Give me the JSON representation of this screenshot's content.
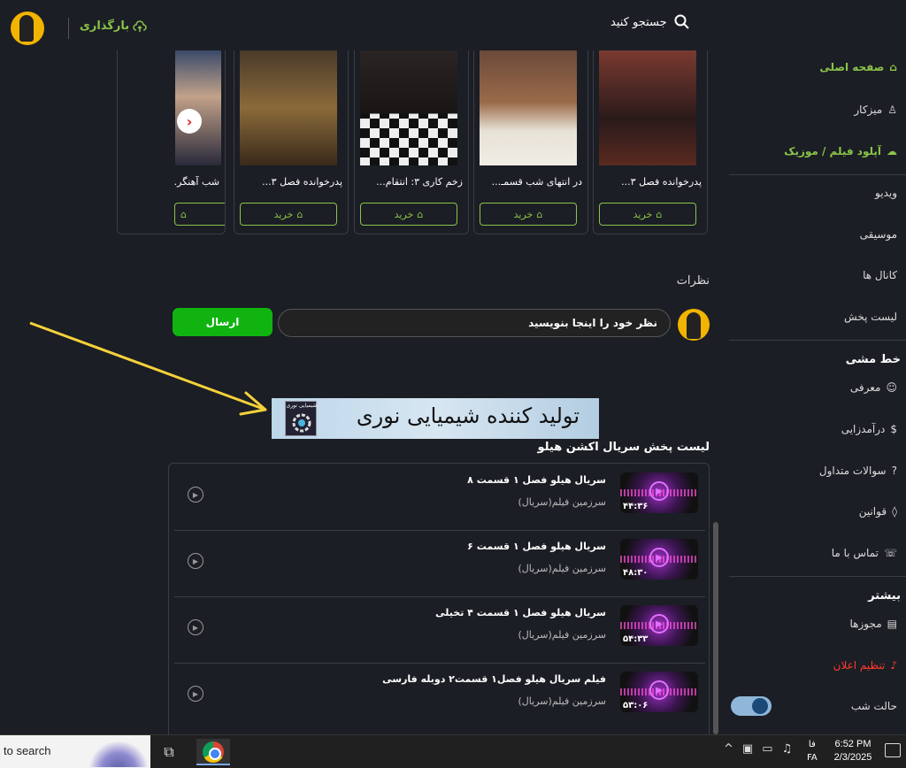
{
  "header": {
    "upload_label": "بارگذاری",
    "search_label": "جستجو کنید"
  },
  "carousel": {
    "cards": [
      {
        "title": "پدرخوانده فصل ۳...",
        "buy_label": "خرید"
      },
      {
        "title": "در انتهای شب قسمـ...",
        "buy_label": "خرید"
      },
      {
        "title": "زخم کاری ۳: انتقام...",
        "buy_label": "خرید"
      },
      {
        "title": "پدرخوانده فصل ۳...",
        "buy_label": "خرید"
      },
      {
        "title": "شب آهنگر...",
        "buy_label": "خرید"
      }
    ]
  },
  "comments": {
    "title": "نظرات",
    "input_placeholder": "نظر خود را اینجا بنویسید",
    "send_label": "ارسال"
  },
  "banner": {
    "text": "تولید کننده شیمیایی نوری",
    "logo_text": "شیمیایی نوری"
  },
  "playlist": {
    "title": "لیست پخش سریال اکشن هیلو",
    "items": [
      {
        "title": "سریال هیلو فصل ۱ قسمت ۸",
        "channel": "سرزمین فیلم(سریال)",
        "duration": "۴۴:۳۶"
      },
      {
        "title": "سریال هیلو فصل ۱ قسمت ۶",
        "channel": "سرزمین فیلم(سریال)",
        "duration": "۴۸:۳۰"
      },
      {
        "title": "سریال هیلو فصل ۱ قسمت ۴ تخیلی",
        "channel": "سرزمین فیلم(سریال)",
        "duration": "۵۴:۳۳"
      },
      {
        "title": "فیلم سریال هیلو فصل۱ قسمت۲ دوبله فارسی",
        "channel": "سرزمین فیلم(سریال)",
        "duration": "۵۳:۰۶"
      }
    ]
  },
  "sidebar": {
    "home": "صفحه اصلی",
    "dashboard": "میزکار",
    "upload": "آپلود فیلم / موزیک",
    "video": "ویدیو",
    "music": "موسیقی",
    "channels": "کانال ها",
    "playlists": "لیست پخش",
    "policy_heading": "خط مشی",
    "about": "معرفی",
    "monetize": "درآمدزایی",
    "faq": "سوالات متداول",
    "rules": "قوانین",
    "contact": "تماس با ما",
    "more_heading": "بیشتر",
    "permits": "مجوزها",
    "ads": "تنظیم اعلان",
    "dark_mode": "حالت شب"
  },
  "taskbar": {
    "search_text": "to search",
    "lang_short": "فا",
    "lang_code": "FA",
    "time": "6:52 PM",
    "date": "2/3/2025"
  },
  "colors": {
    "accent_green": "#8bc34a",
    "send_green": "#10b30f",
    "alert_red": "#ff3b30",
    "arrow_yellow": "#f5d13a"
  }
}
